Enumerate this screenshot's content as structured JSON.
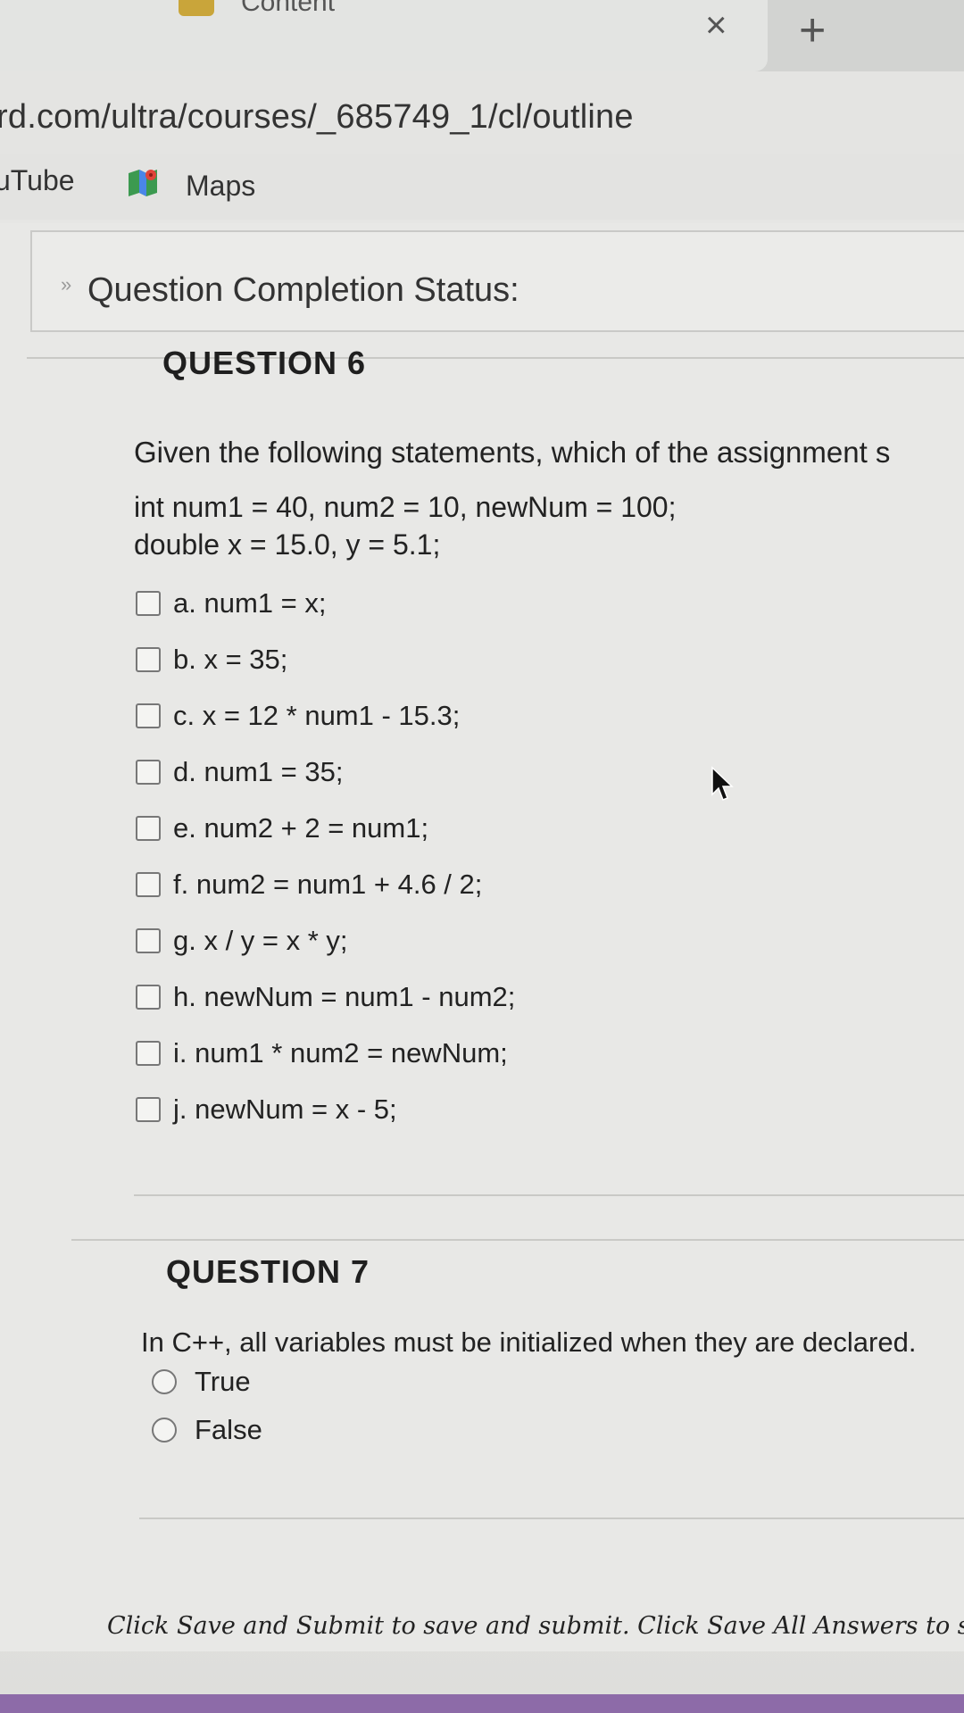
{
  "browser": {
    "tab_title": "Content",
    "tab_close": "×",
    "new_tab": "+",
    "url": "rd.com/ultra/courses/_685749_1/cl/outline",
    "bookmarks": [
      "uTube",
      "Maps"
    ]
  },
  "status": {
    "chevron": "»",
    "label": "Question Completion Status:"
  },
  "question6": {
    "heading": "QUESTION 6",
    "prompt": "Given the following statements, which of the assignment s",
    "code": [
      "int num1 = 40, num2 = 10, newNum = 100;",
      "double x = 15.0, y = 5.1;"
    ],
    "options": [
      "a. num1 = x;",
      "b. x = 35;",
      "c. x = 12 * num1 - 15.3;",
      "d. num1 = 35;",
      "e. num2 + 2 = num1;",
      "f. num2 = num1 + 4.6 / 2;",
      "g. x / y = x * y;",
      "h. newNum = num1 - num2;",
      "i. num1 * num2 = newNum;",
      "j. newNum = x - 5;"
    ]
  },
  "question7": {
    "heading": "QUESTION 7",
    "prompt": "In C++, all variables must be initialized when they are declared.",
    "options": [
      "True",
      "False"
    ]
  },
  "footer": {
    "note": "Click Save and Submit to save and submit. Click Save All Answers to sa"
  }
}
